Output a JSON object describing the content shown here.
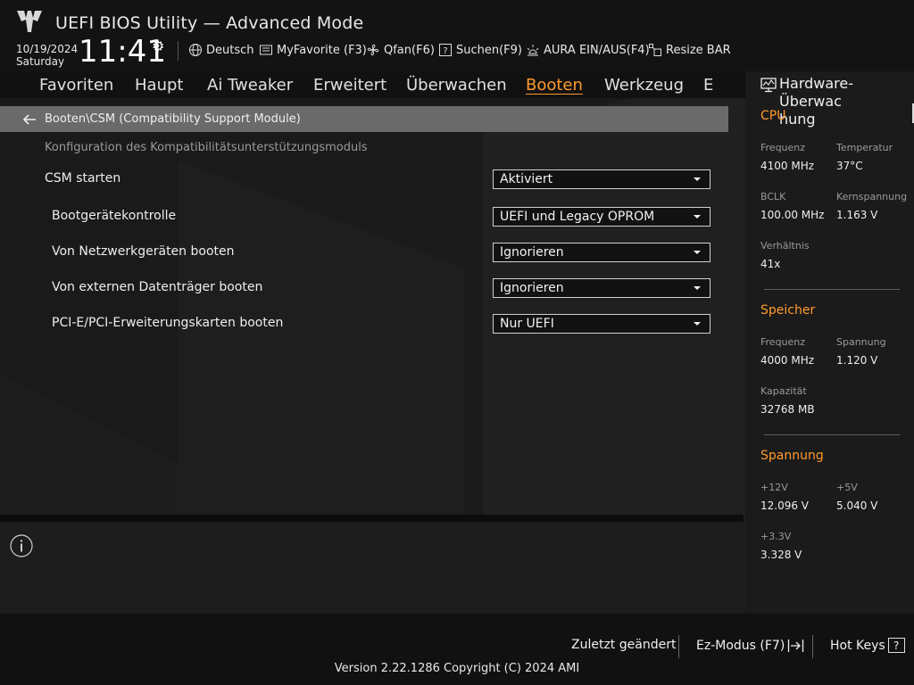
{
  "header": {
    "title": "UEFI BIOS Utility — Advanced Mode",
    "date": "10/19/2024",
    "weekday": "Saturday",
    "time": "11:41",
    "toolbar": [
      {
        "label": "Deutsch",
        "icon": "globe-icon"
      },
      {
        "label": "MyFavorite (F3)",
        "icon": "favorite-icon"
      },
      {
        "label": "Qfan(F6)",
        "icon": "fan-icon"
      },
      {
        "label": "Suchen(F9)",
        "icon": "search-help-icon"
      },
      {
        "label": "AURA EIN/AUS(F4)",
        "icon": "aura-light-icon"
      },
      {
        "label": "Resize BAR",
        "icon": "resize-bar-icon"
      }
    ]
  },
  "tabs": [
    {
      "label": "Favoriten"
    },
    {
      "label": "Haupt"
    },
    {
      "label": "Ai Tweaker"
    },
    {
      "label": "Erweitert"
    },
    {
      "label": "Überwachen"
    },
    {
      "label": "Booten",
      "active": true
    },
    {
      "label": "Werkzeug"
    },
    {
      "label": "E"
    }
  ],
  "breadcrumb": "Booten\\CSM (Compatibility Support Module)",
  "section_description": "Konfiguration des Kompatibilitätsunterstützungsmoduls",
  "settings": [
    {
      "label": "CSM starten",
      "value": "Aktiviert"
    },
    {
      "label": "Bootgerätekontrolle",
      "value": "UEFI und Legacy OPROM"
    },
    {
      "label": "Von Netzwerkgeräten booten",
      "value": "Ignorieren"
    },
    {
      "label": "Von externen Datenträger booten",
      "value": "Ignorieren"
    },
    {
      "label": "PCI-E/PCI-Erweiterungskarten booten",
      "value": "Nur UEFI"
    }
  ],
  "hardware_monitor": {
    "title": "Hardware-Überwachung",
    "title_line1": "Hardware-Überwac",
    "title_line2": "hung",
    "cpu": {
      "heading": "CPU",
      "frequency_label": "Frequenz",
      "frequency": "4100 MHz",
      "temperature_label": "Temperatur",
      "temperature": "37°C",
      "bclk_label": "BCLK",
      "bclk": "100.00 MHz",
      "core_voltage_label": "Kernspannung",
      "core_voltage": "1.163 V",
      "ratio_label": "Verhältnis",
      "ratio": "41x"
    },
    "memory": {
      "heading": "Speicher",
      "frequency_label": "Frequenz",
      "frequency": "4000 MHz",
      "voltage_label": "Spannung",
      "voltage": "1.120 V",
      "capacity_label": "Kapazität",
      "capacity": "32768 MB"
    },
    "voltage": {
      "heading": "Spannung",
      "v12_label": "+12V",
      "v12": "12.096 V",
      "v5_label": "+5V",
      "v5": "5.040 V",
      "v33_label": "+3.3V",
      "v33": "3.328 V"
    }
  },
  "footer": {
    "last_modified": "Zuletzt geändert",
    "ez_mode": "Ez-Modus (F7)",
    "hot_keys": "Hot Keys",
    "hot_keys_key": "?",
    "version": "Version 2.22.1286 Copyright (C) 2024 AMI"
  },
  "colors": {
    "accent": "#ff9a2e",
    "background": "#1a1a1a",
    "breadcrumb_bg": "#6a6a6a"
  }
}
